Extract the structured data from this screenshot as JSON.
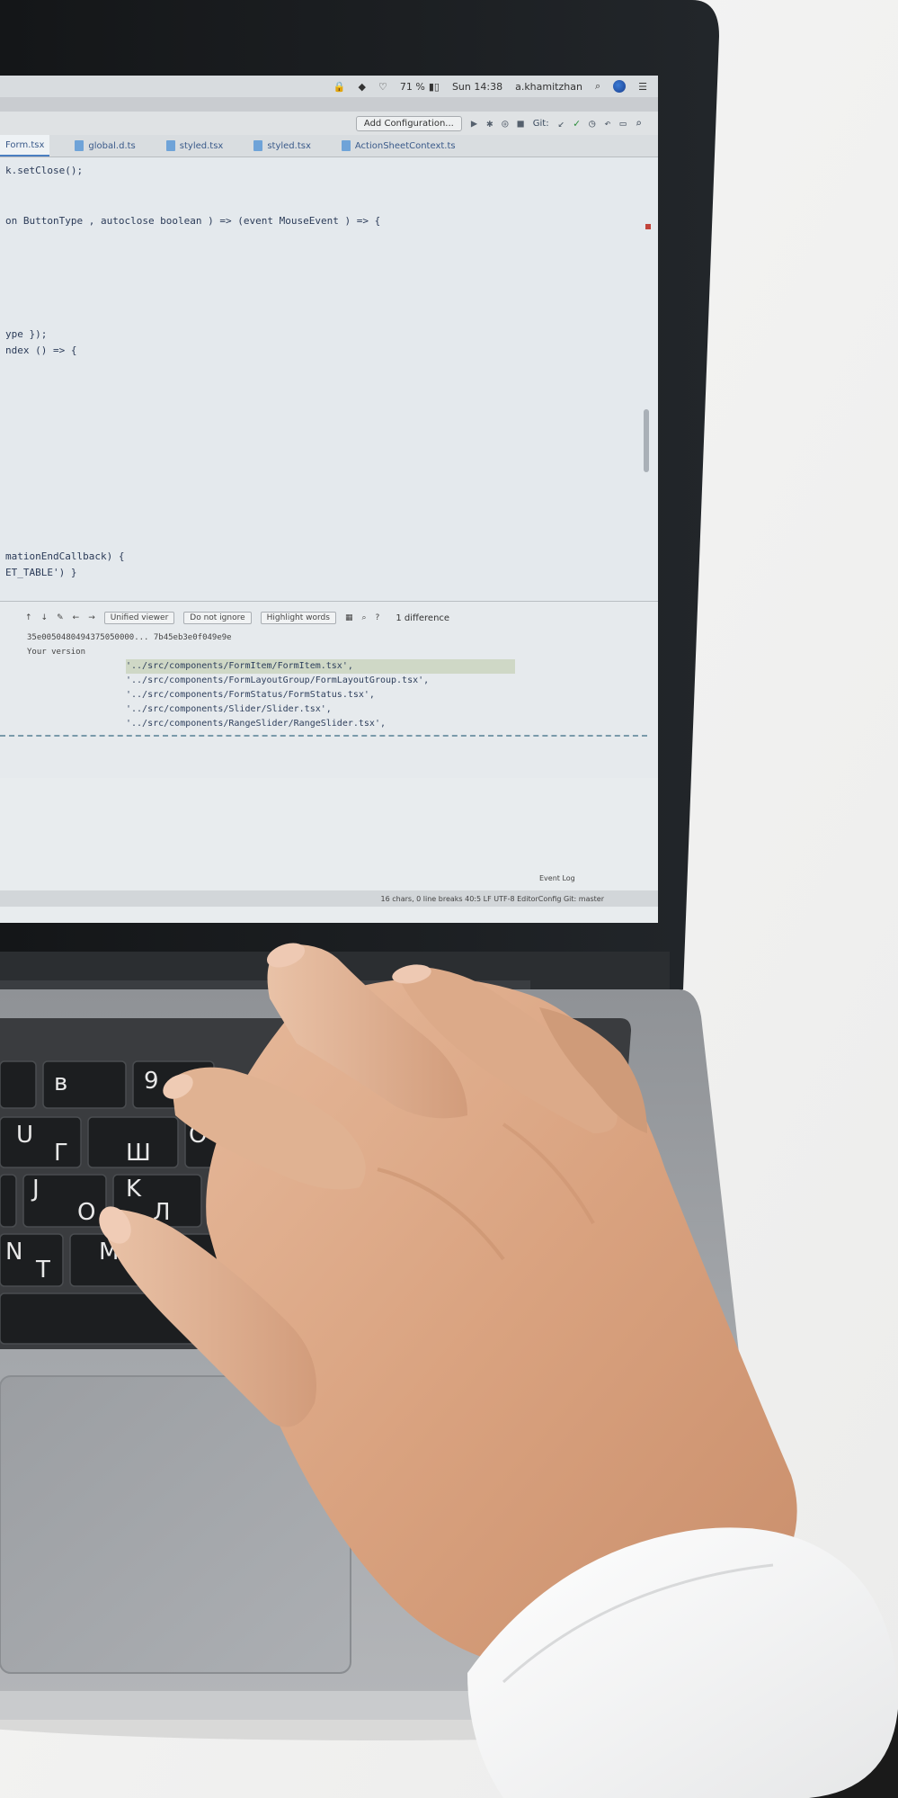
{
  "menubar": {
    "battery": "71 %",
    "clock": "Sun 14:38",
    "user": "a.khamitzhan"
  },
  "toolbar": {
    "config_label": "Add Configuration...",
    "git_label": "Git:"
  },
  "tabs": [
    {
      "label": "Form.tsx"
    },
    {
      "label": "global.d.ts"
    },
    {
      "label": "styled.tsx"
    },
    {
      "label": "styled.tsx"
    },
    {
      "label": "ActionSheetContext.ts"
    }
  ],
  "code": [
    "k.setClose();",
    "on ButtonType , autoclose boolean ) => (event MouseEvent ) => {",
    "",
    "ype });",
    "ndex () => {",
    "mationEndCallback) {",
    "ET_TABLE') }"
  ],
  "diff": {
    "whitespace": "Unified viewer",
    "ignore": "Do not ignore",
    "highlight": "Highlight words",
    "count": "1 difference",
    "hash": "35e0050480494375050000... 7b45eb3e0f049e9e",
    "your_version": "Your version",
    "lines": [
      "'../src/components/FormItem/FormItem.tsx',",
      "'../src/components/FormLayoutGroup/FormLayoutGroup.tsx',",
      "'../src/components/FormStatus/FormStatus.tsx',",
      "'../src/components/Slider/Slider.tsx',",
      "'../src/components/RangeSlider/RangeSlider.tsx',"
    ]
  },
  "status": {
    "event_log": "Event Log",
    "info": "16 chars, 0 line breaks   40:5   LF   UTF-8   EditorConfig   Git: master"
  }
}
